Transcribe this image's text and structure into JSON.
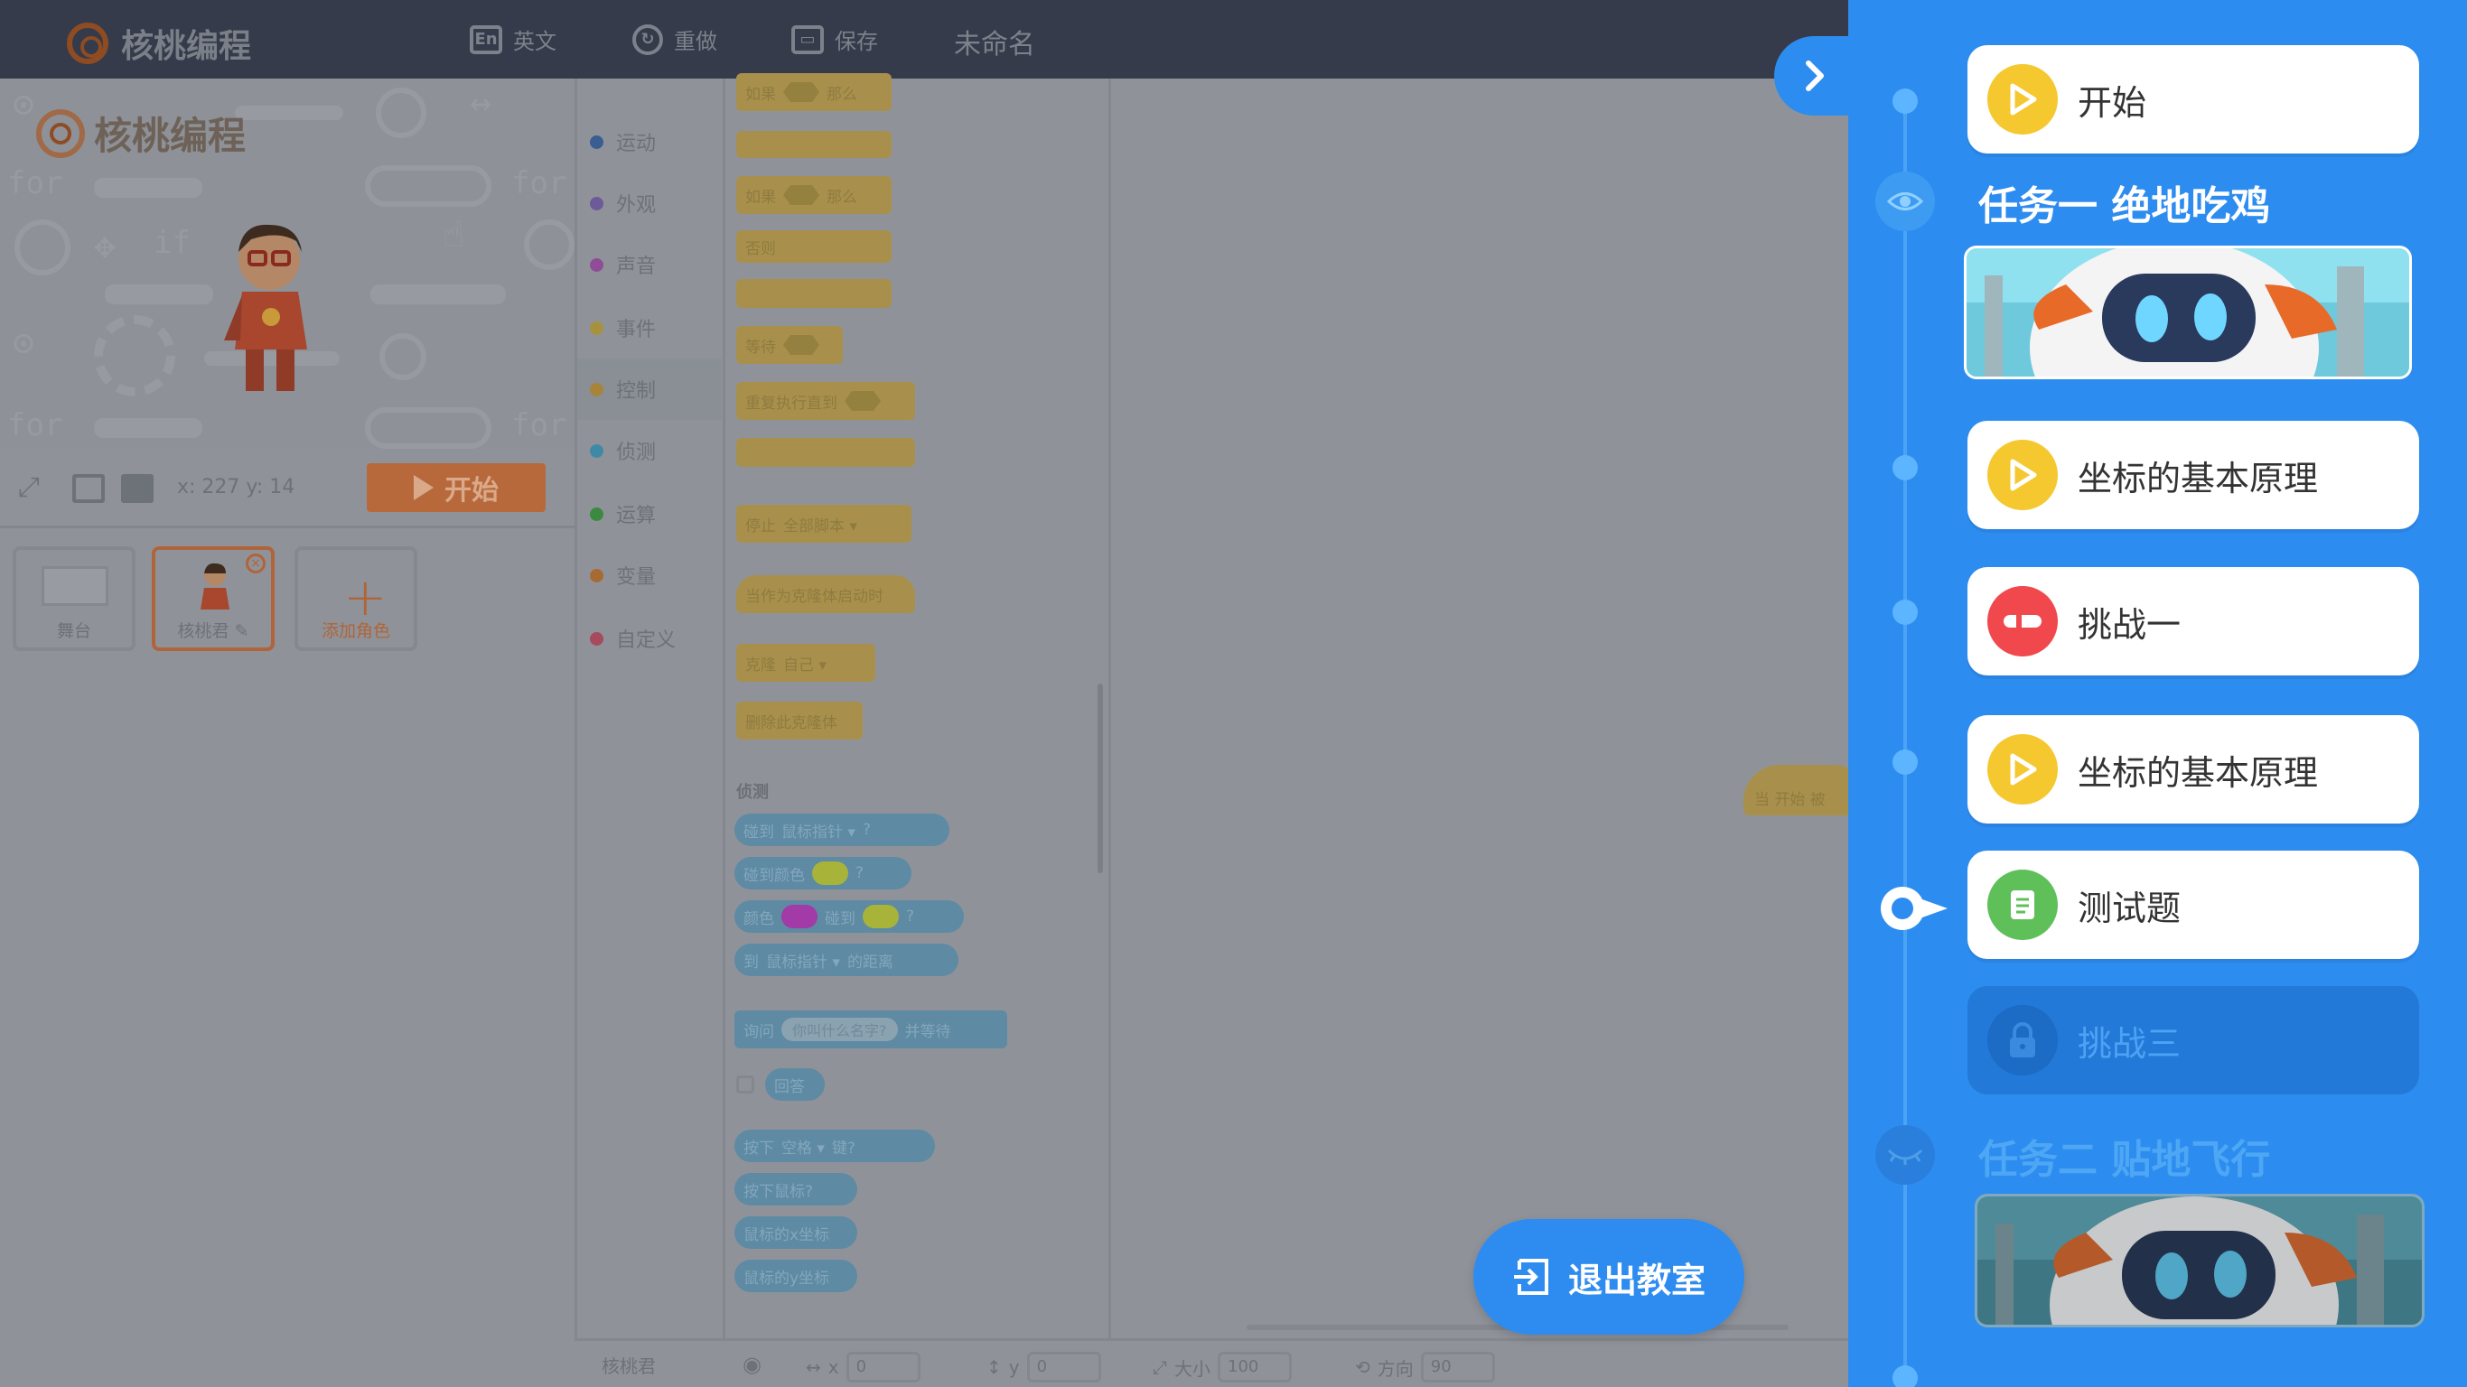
{
  "toolbar": {
    "logo_text": "核桃编程",
    "lang_icon": "En",
    "lang_label": "英文",
    "redo_label": "重做",
    "save_label": "保存",
    "project_title": "未命名"
  },
  "stage": {
    "logo_text": "核桃编程",
    "coords": "x: 227 y: 14",
    "start_label": "开始"
  },
  "sprites": {
    "stage_label": "舞台",
    "sprite_label": "核桃君",
    "add_label": "添加角色"
  },
  "categories": [
    {
      "label": "运动",
      "color": "#3a5d92"
    },
    {
      "label": "外观",
      "color": "#6d5a99"
    },
    {
      "label": "声音",
      "color": "#8e4d96"
    },
    {
      "label": "事件",
      "color": "#a6923e"
    },
    {
      "label": "控制",
      "color": "#a6853b"
    },
    {
      "label": "侦测",
      "color": "#3e8aa6"
    },
    {
      "label": "运算",
      "color": "#3c8a3f"
    },
    {
      "label": "变量",
      "color": "#a66a35"
    },
    {
      "label": "自定义",
      "color": "#a64a5d"
    }
  ],
  "blocks": {
    "if_then": [
      "如果",
      "那么"
    ],
    "if_else": [
      "如果",
      "那么",
      "否则"
    ],
    "wait": "等待",
    "repeat_until": "重复执行直到",
    "stop": [
      "停止",
      "全部脚本 ▾"
    ],
    "when_clone": "当作为克隆体启动时",
    "clone": [
      "克隆",
      "自己 ▾"
    ],
    "delete_clone": "删除此克隆体",
    "sensing_title": "侦测",
    "touching": [
      "碰到",
      "鼠标指针 ▾",
      "?"
    ],
    "touching_color": [
      "碰到颜色",
      "?"
    ],
    "color_touching": [
      "颜色",
      "碰到",
      "?"
    ],
    "distance": [
      "到",
      "鼠标指针 ▾",
      "的距离"
    ],
    "ask": [
      "询问",
      "你叫什么名字?",
      "并等待"
    ],
    "answer": "回答",
    "key_pressed": [
      "按下",
      "空格 ▾",
      "键?"
    ],
    "mouse_down": "按下鼠标?",
    "mouse_x": "鼠标的x坐标",
    "mouse_y": "鼠标的y坐标",
    "hat": "当 开始 被"
  },
  "bottom_bar": {
    "sprite_name": "核桃君",
    "x_label": "x",
    "x_value": "0",
    "y_label": "y",
    "y_value": "0",
    "size_label": "大小",
    "size_value": "100",
    "dir_label": "方向",
    "dir_value": "90"
  },
  "exit_button": "退出教室",
  "sidebar": {
    "start": "开始",
    "mission1": "任务一 绝地吃鸡",
    "items": [
      {
        "label": "坐标的基本原理",
        "icon": "play-icon"
      },
      {
        "label": "挑战一",
        "icon": "challenge-icon"
      },
      {
        "label": "坐标的基本原理",
        "icon": "play-icon"
      },
      {
        "label": "测试题",
        "icon": "quiz-icon"
      },
      {
        "label": "挑战三",
        "icon": "lock-icon"
      }
    ],
    "mission2": "任务二 贴地飞行"
  },
  "colors": {
    "accent": "#2d8cef",
    "play": "#f5c830",
    "challenge": "#f0484c",
    "quiz": "#5fc05a"
  }
}
